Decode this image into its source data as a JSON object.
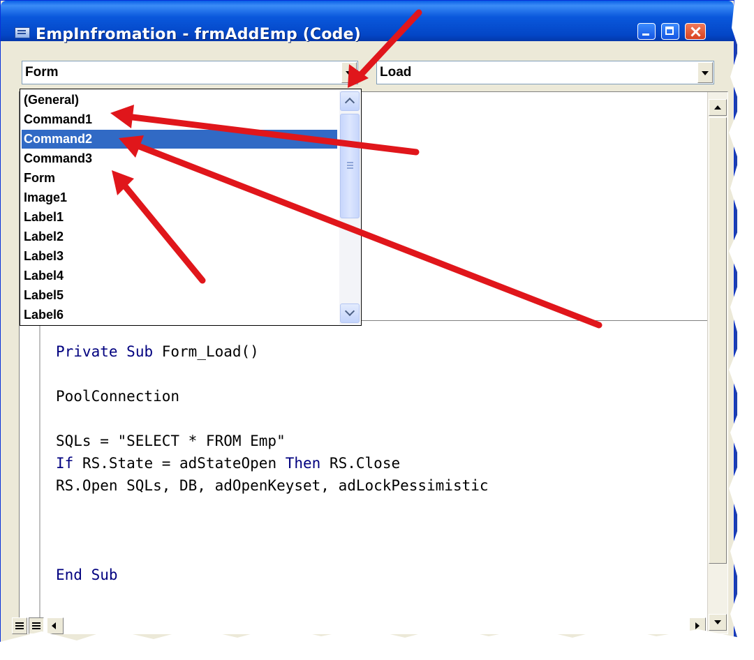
{
  "window": {
    "title": "EmpInfromation - frmAddEmp (Code)"
  },
  "object_combo": {
    "value": "Form"
  },
  "procedure_combo": {
    "value": "Load"
  },
  "object_list": {
    "items": [
      "(General)",
      "Command1",
      "Command2",
      "Command3",
      "Form",
      "Image1",
      "Label1",
      "Label2",
      "Label3",
      "Label4",
      "Label5",
      "Label6"
    ],
    "selected": "Command2"
  },
  "code": {
    "lines": [
      "Private Sub Form_Load()",
      "PoolConnection",
      "SQLs = \"SELECT * FROM Emp\"",
      "If RS.State = adStateOpen Then RS.Close",
      "RS.Open SQLs, DB, adOpenKeyset, adLockPessimistic",
      "End Sub"
    ]
  },
  "colors": {
    "titlebar": "#0a58dc",
    "selection": "#316ac5",
    "keyword": "#00007f",
    "annotation_arrow": "#e0161b"
  },
  "icons": [
    "app-icon",
    "minimize-icon",
    "maximize-icon",
    "close-icon",
    "chevron-up-icon",
    "chevron-down-icon",
    "dropdown-arrow-icon",
    "procedure-view-icon",
    "full-module-view-icon"
  ]
}
